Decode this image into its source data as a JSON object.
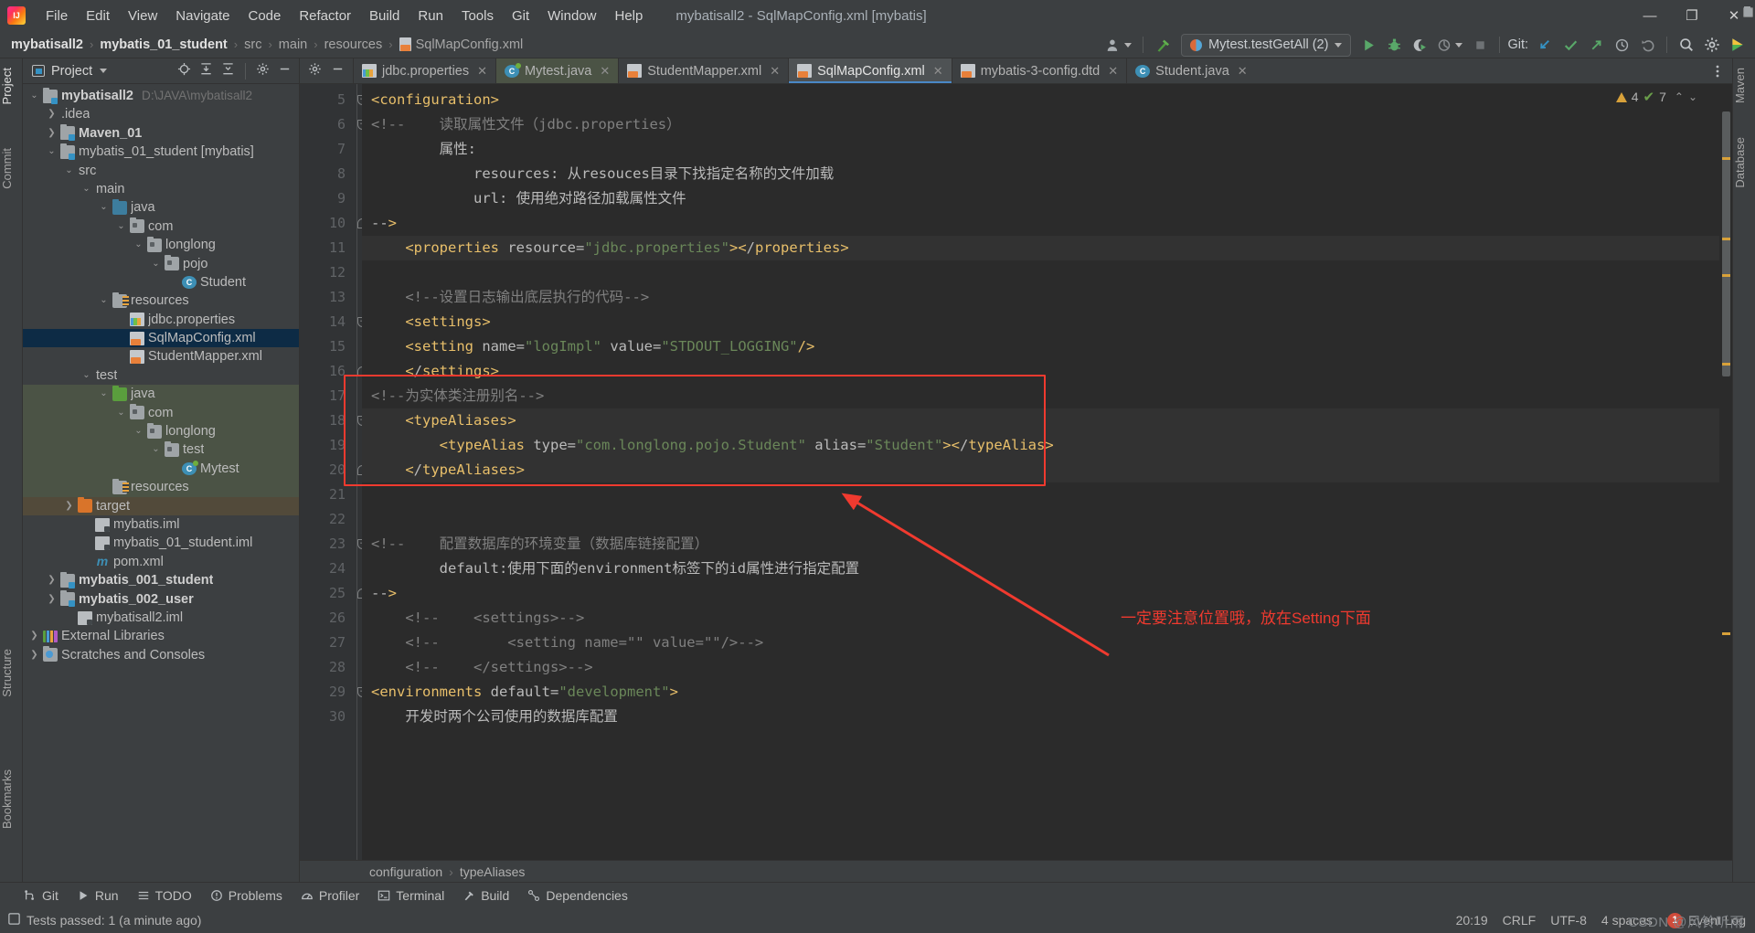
{
  "window": {
    "title": "mybatisall2 - SqlMapConfig.xml [mybatis]",
    "minimize": "—",
    "maximize": "❐",
    "close": "✕"
  },
  "menubar": {
    "logo": "IJ",
    "items": [
      "File",
      "Edit",
      "View",
      "Navigate",
      "Code",
      "Refactor",
      "Build",
      "Run",
      "Tools",
      "Git",
      "Window",
      "Help"
    ]
  },
  "navbar": {
    "crumbs": [
      "mybatisall2",
      "mybatis_01_student",
      "src",
      "main",
      "resources",
      "SqlMapConfig.xml"
    ],
    "separator": "›",
    "run_config": "Mytest.testGetAll (2)",
    "git_label": "Git:"
  },
  "left_strip": {
    "project": "Project",
    "commit": "Commit",
    "structure": "Structure",
    "bookmarks": "Bookmarks"
  },
  "right_strip": {
    "maven": "Maven",
    "database": "Database"
  },
  "project_panel": {
    "title": "Project",
    "tree": [
      {
        "label": "mybatisall2",
        "sub": "D:\\JAVA\\mybatisall2",
        "depth": 0,
        "tw": "v",
        "icon": "mod",
        "bold": true,
        "bg": ""
      },
      {
        "label": ".idea",
        "sub": "",
        "depth": 1,
        "tw": ">",
        "icon": "fold",
        "bold": false,
        "bg": ""
      },
      {
        "label": "Maven_01",
        "sub": "",
        "depth": 1,
        "tw": ">",
        "icon": "mod",
        "bold": true,
        "bg": ""
      },
      {
        "label": "mybatis_01_student [mybatis]",
        "sub": "",
        "depth": 1,
        "tw": "v",
        "icon": "mod",
        "bold": false,
        "bg": ""
      },
      {
        "label": "src",
        "sub": "",
        "depth": 2,
        "tw": "v",
        "icon": "fold",
        "bold": false,
        "bg": ""
      },
      {
        "label": "main",
        "sub": "",
        "depth": 3,
        "tw": "v",
        "icon": "fold",
        "bold": false,
        "bg": ""
      },
      {
        "label": "java",
        "sub": "",
        "depth": 4,
        "tw": "v",
        "icon": "src",
        "bold": false,
        "bg": ""
      },
      {
        "label": "com",
        "sub": "",
        "depth": 5,
        "tw": "v",
        "icon": "pkg",
        "bold": false,
        "bg": ""
      },
      {
        "label": "longlong",
        "sub": "",
        "depth": 6,
        "tw": "v",
        "icon": "pkg",
        "bold": false,
        "bg": ""
      },
      {
        "label": "pojo",
        "sub": "",
        "depth": 7,
        "tw": "v",
        "icon": "pkg",
        "bold": false,
        "bg": ""
      },
      {
        "label": "Student",
        "sub": "",
        "depth": 8,
        "tw": "",
        "icon": "cls",
        "bold": false,
        "bg": ""
      },
      {
        "label": "resources",
        "sub": "",
        "depth": 4,
        "tw": "v",
        "icon": "res",
        "bold": false,
        "bg": ""
      },
      {
        "label": "jdbc.properties",
        "sub": "",
        "depth": 5,
        "tw": "",
        "icon": "prop",
        "bold": false,
        "bg": ""
      },
      {
        "label": "SqlMapConfig.xml",
        "sub": "",
        "depth": 5,
        "tw": "",
        "icon": "xml",
        "bold": false,
        "bg": "sel"
      },
      {
        "label": "StudentMapper.xml",
        "sub": "",
        "depth": 5,
        "tw": "",
        "icon": "xml",
        "bold": false,
        "bg": ""
      },
      {
        "label": "test",
        "sub": "",
        "depth": 3,
        "tw": "v",
        "icon": "fold",
        "bold": false,
        "bg": ""
      },
      {
        "label": "java",
        "sub": "",
        "depth": 4,
        "tw": "v",
        "icon": "tsrc",
        "bold": false,
        "bg": "greenbg"
      },
      {
        "label": "com",
        "sub": "",
        "depth": 5,
        "tw": "v",
        "icon": "pkg",
        "bold": false,
        "bg": "greenbg"
      },
      {
        "label": "longlong",
        "sub": "",
        "depth": 6,
        "tw": "v",
        "icon": "pkg",
        "bold": false,
        "bg": "greenbg"
      },
      {
        "label": "test",
        "sub": "",
        "depth": 7,
        "tw": "v",
        "icon": "pkg",
        "bold": false,
        "bg": "greenbg"
      },
      {
        "label": "Mytest",
        "sub": "",
        "depth": 8,
        "tw": "",
        "icon": "clstest",
        "bold": false,
        "bg": "greenbg"
      },
      {
        "label": "resources",
        "sub": "",
        "depth": 4,
        "tw": "",
        "icon": "tres",
        "bold": false,
        "bg": "greenbg"
      },
      {
        "label": "target",
        "sub": "",
        "depth": 2,
        "tw": ">",
        "icon": "tgt",
        "bold": false,
        "bg": "brownbg"
      },
      {
        "label": "mybatis.iml",
        "sub": "",
        "depth": 3,
        "tw": "",
        "icon": "iml",
        "bold": false,
        "bg": ""
      },
      {
        "label": "mybatis_01_student.iml",
        "sub": "",
        "depth": 3,
        "tw": "",
        "icon": "iml",
        "bold": false,
        "bg": ""
      },
      {
        "label": "pom.xml",
        "sub": "",
        "depth": 3,
        "tw": "",
        "icon": "pom",
        "bold": false,
        "bg": ""
      },
      {
        "label": "mybatis_001_student",
        "sub": "",
        "depth": 1,
        "tw": ">",
        "icon": "mod",
        "bold": true,
        "bg": ""
      },
      {
        "label": "mybatis_002_user",
        "sub": "",
        "depth": 1,
        "tw": ">",
        "icon": "mod",
        "bold": true,
        "bg": ""
      },
      {
        "label": "mybatisall2.iml",
        "sub": "",
        "depth": 2,
        "tw": "",
        "icon": "iml",
        "bold": false,
        "bg": ""
      },
      {
        "label": "External Libraries",
        "sub": "",
        "depth": 0,
        "tw": ">",
        "icon": "lib",
        "bold": false,
        "bg": ""
      },
      {
        "label": "Scratches and Consoles",
        "sub": "",
        "depth": 0,
        "tw": ">",
        "icon": "scr",
        "bold": false,
        "bg": ""
      }
    ]
  },
  "editor_tabs": [
    {
      "label": "jdbc.properties",
      "icon": "prop",
      "state": "normal"
    },
    {
      "label": "Mytest.java",
      "icon": "clstest",
      "state": "modified"
    },
    {
      "label": "StudentMapper.xml",
      "icon": "xml",
      "state": "normal"
    },
    {
      "label": "SqlMapConfig.xml",
      "icon": "xml",
      "state": "active"
    },
    {
      "label": "mybatis-3-config.dtd",
      "icon": "xml",
      "state": "normal"
    },
    {
      "label": "Student.java",
      "icon": "cls",
      "state": "normal"
    }
  ],
  "inspection": {
    "warnings": "4",
    "weak_warnings": "7"
  },
  "code": {
    "first_line": 5,
    "lines": [
      {
        "n": 5,
        "fold": "down",
        "text": "<configuration>"
      },
      {
        "n": 6,
        "fold": "down",
        "text": "<!--    读取属性文件（jdbc.properties）"
      },
      {
        "n": 7,
        "fold": "",
        "text": "        属性:"
      },
      {
        "n": 8,
        "fold": "",
        "text": "            resources: 从resouces目录下找指定名称的文件加载"
      },
      {
        "n": 9,
        "fold": "",
        "text": "            url: 使用绝对路径加载属性文件"
      },
      {
        "n": 10,
        "fold": "up",
        "text": "-->"
      },
      {
        "n": 11,
        "fold": "",
        "text": "    <properties resource=\"jdbc.properties\"></properties>"
      },
      {
        "n": 12,
        "fold": "",
        "text": ""
      },
      {
        "n": 13,
        "fold": "",
        "text": "    <!--设置日志输出底层执行的代码-->"
      },
      {
        "n": 14,
        "fold": "down",
        "text": "    <settings>"
      },
      {
        "n": 15,
        "fold": "",
        "text": "    <setting name=\"logImpl\" value=\"STDOUT_LOGGING\"/>"
      },
      {
        "n": 16,
        "fold": "up",
        "text": "    </settings>"
      },
      {
        "n": 17,
        "fold": "",
        "text": "<!--为实体类注册别名-->"
      },
      {
        "n": 18,
        "fold": "down",
        "text": "    <typeAliases>"
      },
      {
        "n": 19,
        "fold": "",
        "text": "        <typeAlias type=\"com.longlong.pojo.Student\" alias=\"Student\"></typeAlias>"
      },
      {
        "n": 20,
        "fold": "up",
        "text": "    </typeAliases>"
      },
      {
        "n": 21,
        "fold": "",
        "text": ""
      },
      {
        "n": 22,
        "fold": "",
        "text": ""
      },
      {
        "n": 23,
        "fold": "down",
        "text": "<!--    配置数据库的环境变量（数据库链接配置）"
      },
      {
        "n": 24,
        "fold": "",
        "text": "        default:使用下面的environment标签下的id属性进行指定配置"
      },
      {
        "n": 25,
        "fold": "up",
        "text": "-->"
      },
      {
        "n": 26,
        "fold": "",
        "text": "    <!--    <settings>-->"
      },
      {
        "n": 27,
        "fold": "",
        "text": "    <!--        <setting name=\"\" value=\"\"/>-->"
      },
      {
        "n": 28,
        "fold": "",
        "text": "    <!--    </settings>-->"
      },
      {
        "n": 29,
        "fold": "down",
        "text": "<environments default=\"development\">"
      },
      {
        "n": 30,
        "fold": "",
        "text": "    开发时两个公司使用的数据库配置"
      }
    ]
  },
  "annotation": {
    "text": "一定要注意位置哦，放在Setting下面",
    "color": "#f03a2f"
  },
  "editor_breadcrumb": {
    "items": [
      "configuration",
      "typeAliases"
    ],
    "separator": "›"
  },
  "toolwindows": [
    {
      "label": "Git",
      "icon": "git-icon"
    },
    {
      "label": "Run",
      "icon": "run-icon"
    },
    {
      "label": "TODO",
      "icon": "todo-icon"
    },
    {
      "label": "Problems",
      "icon": "problems-icon"
    },
    {
      "label": "Profiler",
      "icon": "profiler-icon"
    },
    {
      "label": "Terminal",
      "icon": "terminal-icon"
    },
    {
      "label": "Build",
      "icon": "build-icon"
    },
    {
      "label": "Dependencies",
      "icon": "dependencies-icon"
    }
  ],
  "statusbar": {
    "message": "Tests passed: 1 (a minute ago)",
    "position": "20:19",
    "line_sep": "CRLF",
    "encoding": "UTF-8",
    "indent": "4 spaces",
    "event_log": "Event Log",
    "event_count": "1",
    "watermark": "CSDN @风铃听雨"
  }
}
